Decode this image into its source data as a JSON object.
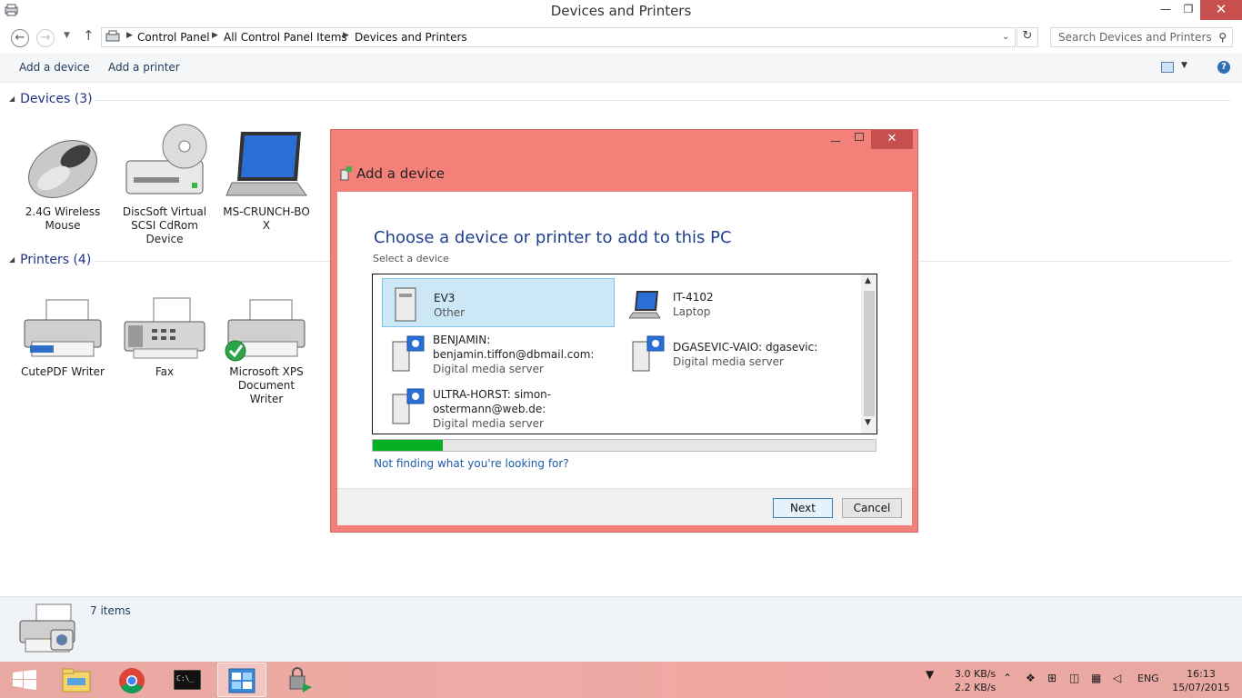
{
  "window": {
    "title": "Devices and Printers"
  },
  "address": {
    "crumbs": [
      "Control Panel",
      "All Control Panel Items",
      "Devices and Printers"
    ],
    "search_placeholder": "Search Devices and Printers"
  },
  "commands": {
    "add_device": "Add a device",
    "add_printer": "Add a printer"
  },
  "groups": {
    "devices": {
      "header": "Devices (3)",
      "items": [
        {
          "label_line1": "2.4G Wireless",
          "label_line2": "Mouse",
          "icon": "mouse-icon"
        },
        {
          "label_line1": "DiscSoft Virtual",
          "label_line2": "SCSI CdRom",
          "label_line3": "Device",
          "icon": "cdrom-icon"
        },
        {
          "label_line1": "MS-CRUNCH-BO",
          "label_line2": "X",
          "icon": "laptop-icon"
        }
      ]
    },
    "printers": {
      "header": "Printers (4)",
      "items": [
        {
          "label_line1": "CutePDF Writer",
          "icon": "printer-icon"
        },
        {
          "label_line1": "Fax",
          "icon": "fax-icon"
        },
        {
          "label_line1": "Microsoft XPS",
          "label_line2": "Document Writer",
          "icon": "printer-default-icon"
        }
      ]
    }
  },
  "details": {
    "count": "7 items"
  },
  "dialog": {
    "title": "Add a device",
    "heading": "Choose a device or printer to add to this PC",
    "subheading": "Select a device",
    "devices": [
      {
        "name": "EV3",
        "type": "Other",
        "selected": true
      },
      {
        "name": "IT-4102",
        "type": "Laptop",
        "selected": false
      },
      {
        "name_line1": "BENJAMIN:",
        "name_line2": "benjamin.tiffon@dbmail.com:",
        "type": "Digital media server",
        "selected": false
      },
      {
        "name_line1": "DGASEVIC-VAIO: dgasevic:",
        "type": "Digital media server",
        "selected": false
      },
      {
        "name_line1": "ULTRA-HORST: simon-",
        "name_line2": "ostermann@web.de:",
        "type": "Digital media server",
        "selected": false
      }
    ],
    "progress": 0.14,
    "not_finding_link": "Not finding what you're looking for?",
    "next_label": "Next",
    "cancel_label": "Cancel"
  },
  "taskbar": {
    "netspeed_up": "3.0 KB/s",
    "netspeed_down": "2.2 KB/s",
    "language": "ENG",
    "time": "16:13",
    "date": "15/07/2015"
  },
  "colors": {
    "dialog_frame": "#f3817a",
    "close_button": "#c7504e",
    "selection": "#cce8f7",
    "progress_fill": "#06b025",
    "link": "#1e5aa8",
    "heading": "#1e3f8f"
  }
}
